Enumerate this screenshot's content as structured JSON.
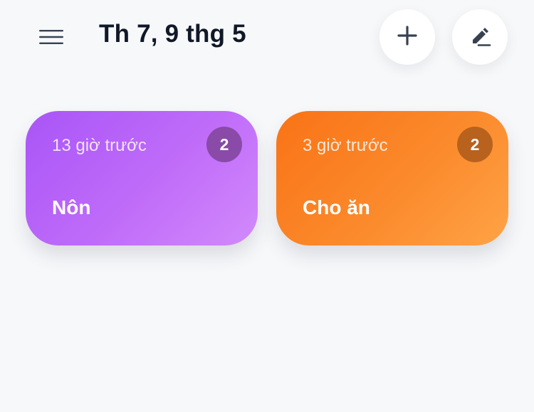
{
  "header": {
    "menu_icon": "hamburger-menu-icon",
    "title": "Th 7, 9 thg 5",
    "add_icon": "plus-icon",
    "edit_icon": "pencil-icon"
  },
  "cards": [
    {
      "time": "13 giờ trước",
      "count": "2",
      "label": "Nôn",
      "color_start": "#a955f7",
      "color_end": "#d28afb"
    },
    {
      "time": "3 giờ trước",
      "count": "2",
      "label": "Cho ăn",
      "color_start": "#f97316",
      "color_end": "#fea346"
    }
  ],
  "colors": {
    "background": "#f7f8fa",
    "title_text": "#111827",
    "icon_stroke": "#374151"
  }
}
